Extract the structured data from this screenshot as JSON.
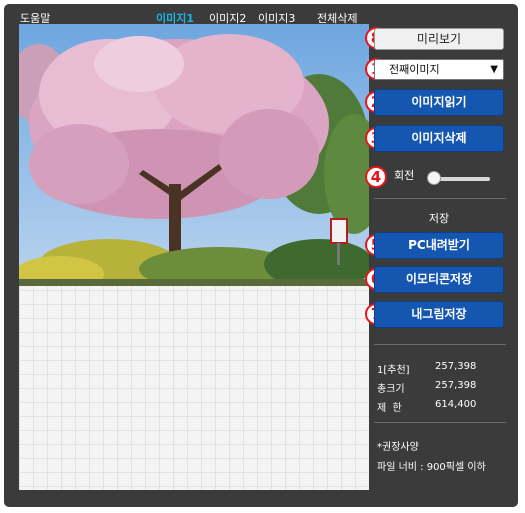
{
  "topbar": {
    "help": "도움말",
    "tabs": [
      {
        "label": "이미지1",
        "active": true
      },
      {
        "label": "이미지2",
        "active": false
      },
      {
        "label": "이미지3",
        "active": false
      }
    ],
    "delete_all": "전체삭제"
  },
  "panel": {
    "preview_label": "미리보기",
    "select_value": "전째이미지",
    "load_label": "이미지읽기",
    "delete_label": "이미지삭제",
    "rotate_label": "회전",
    "rotate_value": 0,
    "save_heading": "저장",
    "download_label": "PC내려받기",
    "emoticon_label": "이모티콘저장",
    "mypic_label": "내그림저장",
    "markers": [
      "8",
      "1",
      "2",
      "3",
      "4",
      "5",
      "6",
      "7"
    ]
  },
  "stats": [
    {
      "label": "1[추천]",
      "value": "257,398"
    },
    {
      "label": "총크기",
      "value": "257,398"
    },
    {
      "label": "제  한",
      "value": "614,400"
    }
  ],
  "notes": {
    "title": "*권장사양",
    "line": "파일 너비 : 900픽셀 이하"
  },
  "colors": {
    "frame_bg": "#3b3b3b",
    "active_tab": "#19b6e6",
    "button_blue": "#1556b0",
    "marker_red": "#e8141a"
  }
}
